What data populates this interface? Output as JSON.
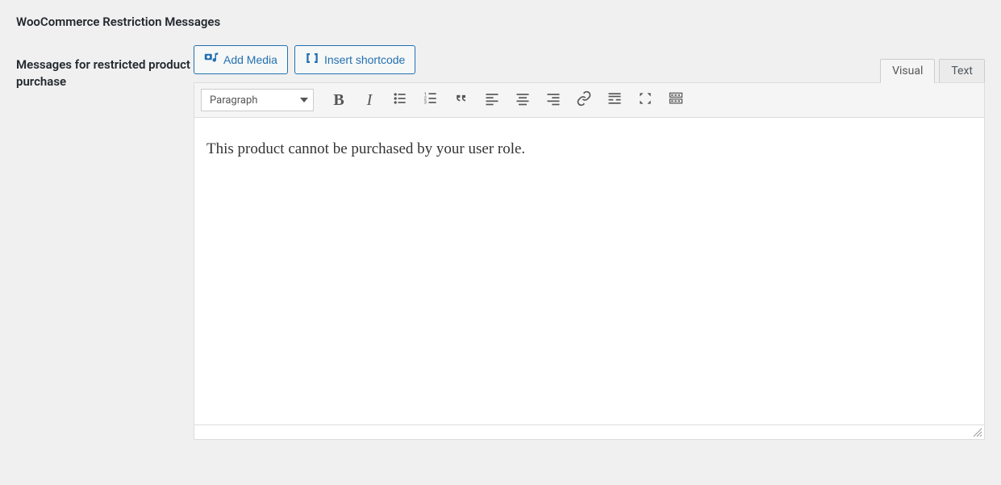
{
  "section": {
    "title": "WooCommerce Restriction Messages"
  },
  "field": {
    "label": "Messages for restricted product purchase"
  },
  "buttons": {
    "add_media": "Add Media",
    "insert_shortcode": "Insert shortcode"
  },
  "tabs": {
    "visual": "Visual",
    "text": "Text",
    "active": "visual"
  },
  "toolbar": {
    "format": "Paragraph",
    "items": [
      "bold",
      "italic",
      "ul",
      "ol",
      "quote",
      "align-left",
      "align-center",
      "align-right",
      "link",
      "more",
      "fullscreen",
      "kitchensink"
    ]
  },
  "editor": {
    "content": "This product cannot be purchased by your user role."
  }
}
